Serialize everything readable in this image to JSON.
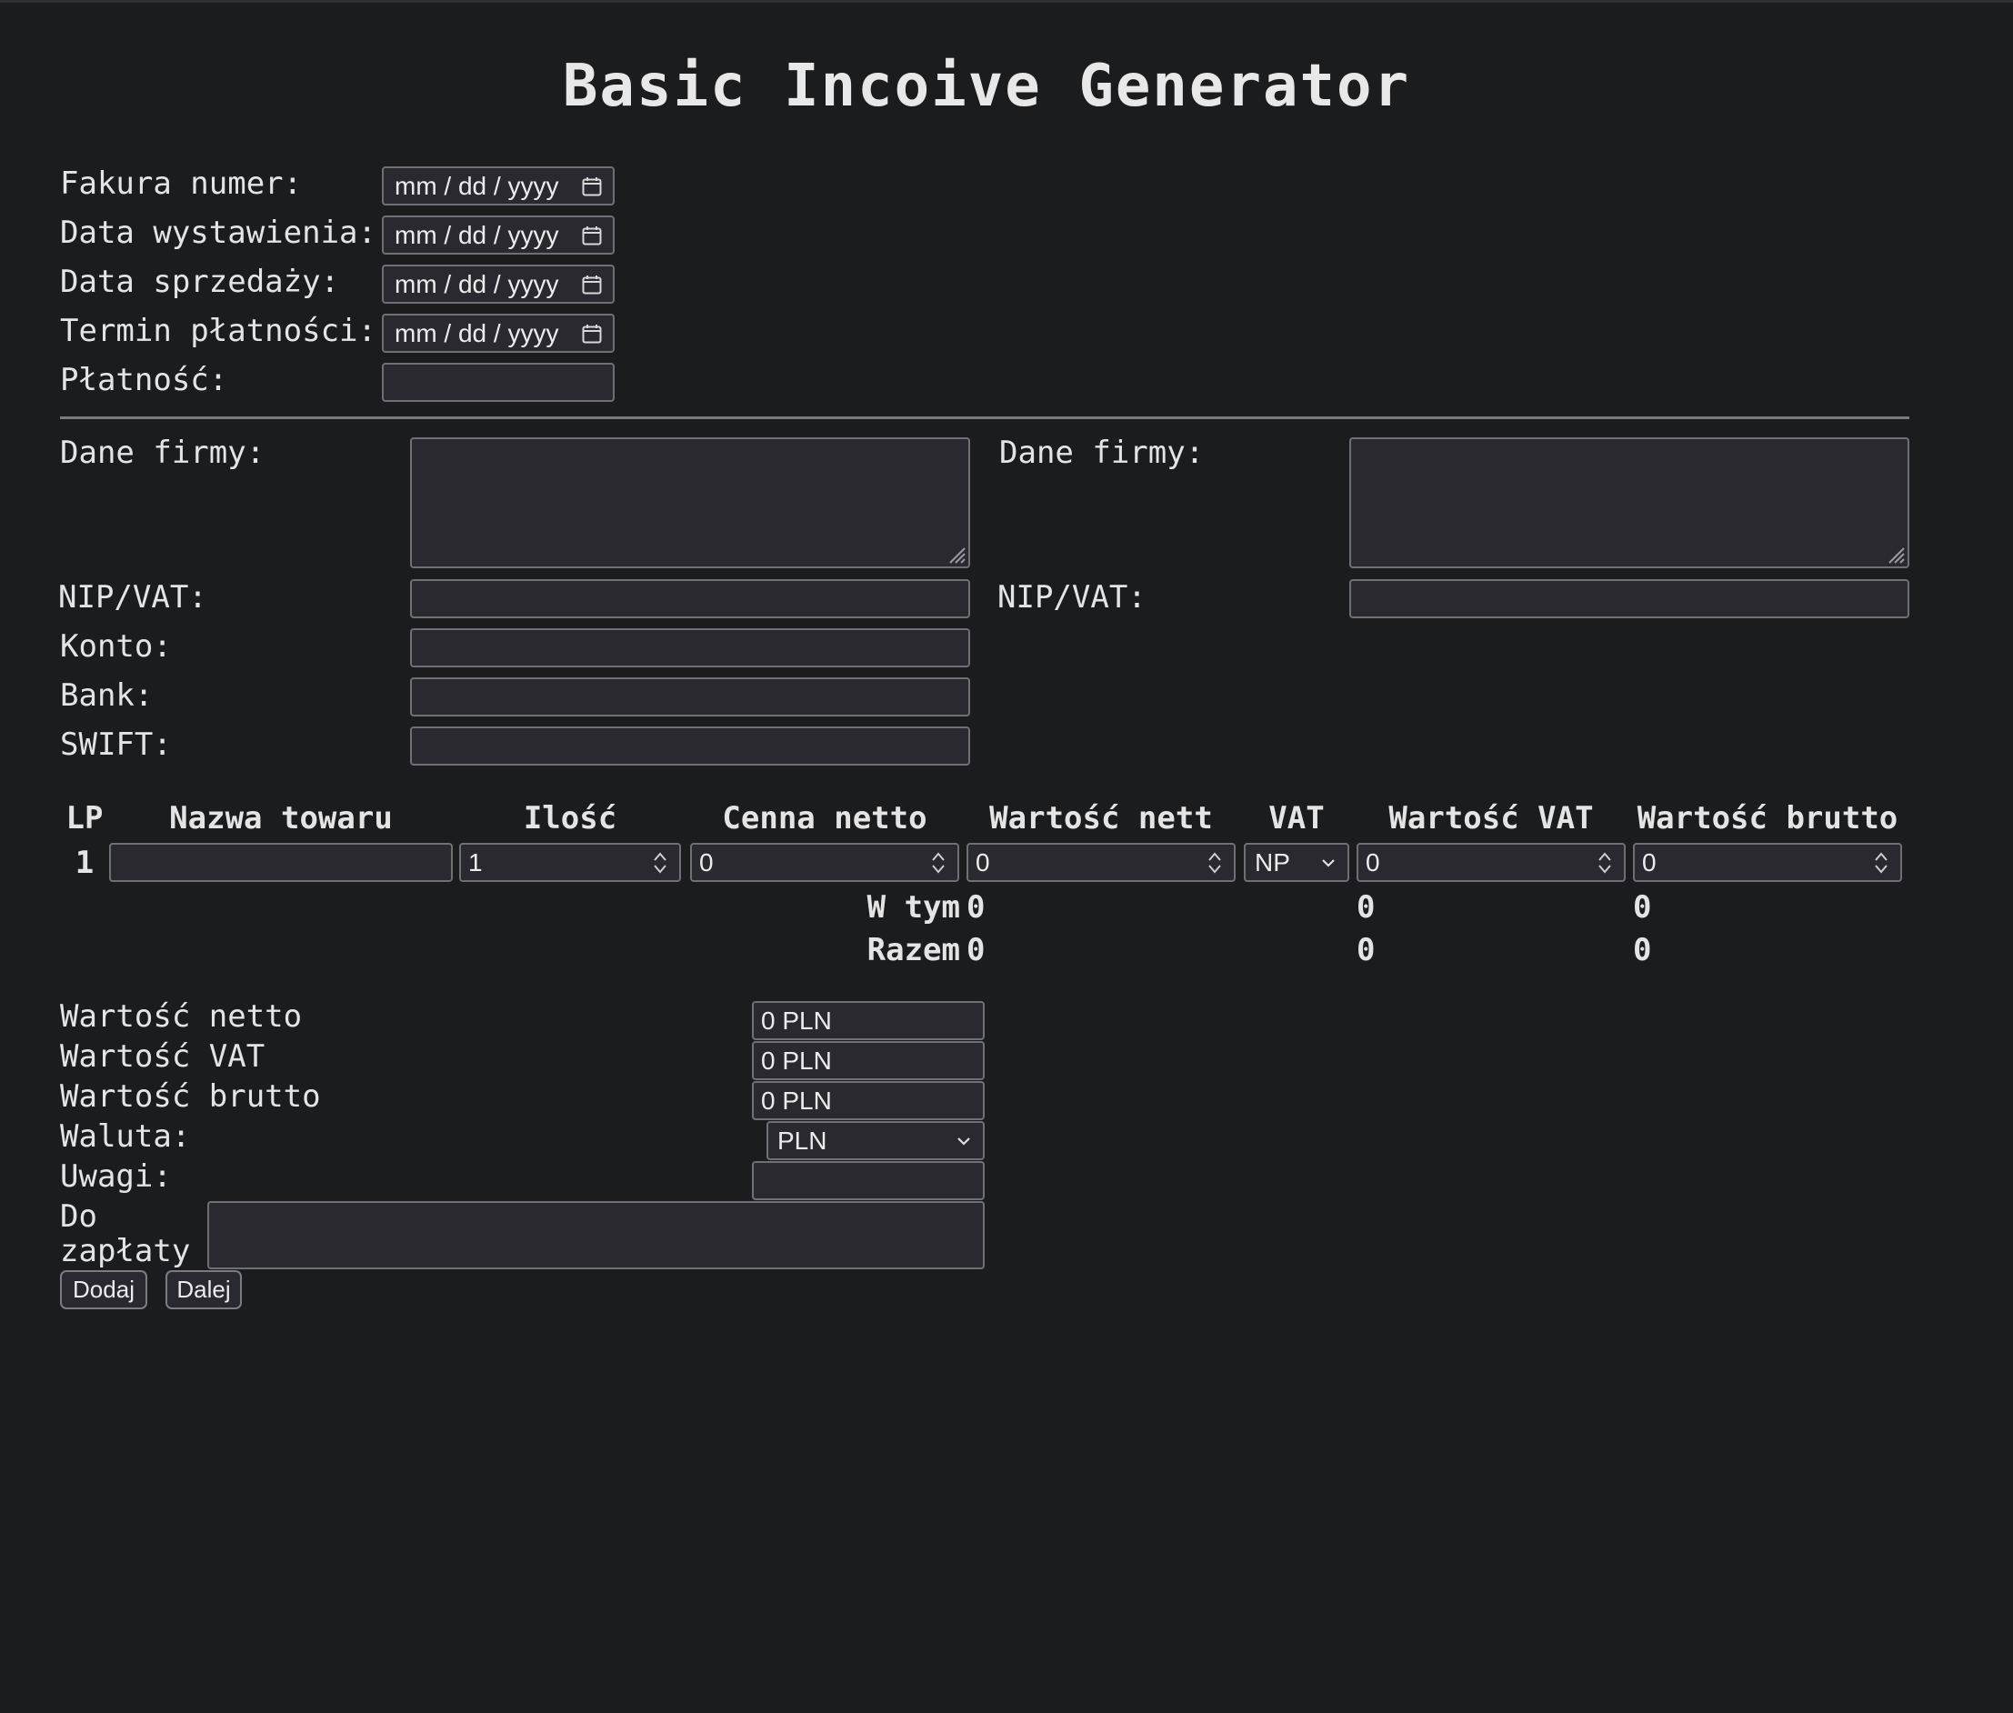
{
  "title": "Basic Incoive Generator",
  "header_fields": [
    {
      "label": "Fakura numer:",
      "placeholder": "mm / dd / yyyy"
    },
    {
      "label": "Data wystawienia:",
      "placeholder": "mm / dd / yyyy"
    },
    {
      "label": "Data sprzedaży:",
      "placeholder": "mm / dd / yyyy"
    },
    {
      "label": "Termin płatności:",
      "placeholder": "mm / dd / yyyy"
    },
    {
      "label": "Płatność:",
      "value": ""
    }
  ],
  "seller": {
    "company_label": "Dane firmy:",
    "nip_label": "NIP/VAT:",
    "konto_label": "Konto:",
    "bank_label": "Bank:",
    "swift_label": "SWIFT:"
  },
  "buyer": {
    "company_label": "Dane firmy:",
    "nip_label": "NIP/VAT:"
  },
  "table": {
    "headers": [
      "LP",
      "Nazwa towaru",
      "Ilość",
      "Cenna netto",
      "Wartość nett",
      "VAT",
      "Wartość VAT",
      "Wartość brutto"
    ],
    "rows": [
      {
        "lp": "1",
        "name": "",
        "qty": "1",
        "price_net": "0",
        "value_net": "0",
        "vat": "NP",
        "value_vat": "0",
        "value_gross": "0"
      }
    ],
    "w_tym": {
      "label": "W tym",
      "net": "0",
      "vat": "0",
      "gross": "0"
    },
    "razem": {
      "label": "Razem",
      "net": "0",
      "vat": "0",
      "gross": "0"
    }
  },
  "summary": {
    "net_label": "Wartość netto",
    "net_value": "0 PLN",
    "vat_label": "Wartość VAT",
    "vat_value": "0 PLN",
    "gross_label": "Wartość brutto",
    "gross_value": "0 PLN",
    "currency_label": "Waluta:",
    "currency_value": "PLN",
    "notes_label": "Uwagi:",
    "due_label_1": "Do",
    "due_label_2": "zapłaty"
  },
  "buttons": {
    "add": "Dodaj",
    "next": "Dalej"
  },
  "icons": {
    "date": "calendar-icon",
    "number": "spinner-icon",
    "select": "chevron-down-icon",
    "textarea": "resize-grip-icon"
  }
}
